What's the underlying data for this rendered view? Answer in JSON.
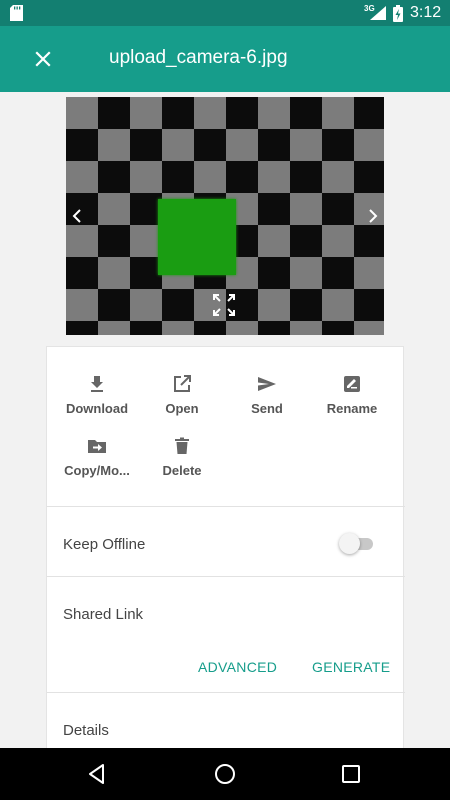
{
  "status_bar": {
    "network": "3G",
    "time": "3:12",
    "icons": [
      "sd-card-icon",
      "signal-icon",
      "battery-charging-icon"
    ]
  },
  "app_bar": {
    "title": "upload_camera-6.jpg",
    "close_icon": "close-icon"
  },
  "preview": {
    "icons": [
      "chevron-left-icon",
      "chevron-right-icon",
      "fullscreen-icon"
    ]
  },
  "actions": [
    {
      "label": "Download",
      "icon": "download-icon"
    },
    {
      "label": "Open",
      "icon": "open-external-icon"
    },
    {
      "label": "Send",
      "icon": "send-icon"
    },
    {
      "label": "Rename",
      "icon": "rename-icon"
    },
    {
      "label": "Copy/Mo...",
      "icon": "copy-move-icon"
    },
    {
      "label": "Delete",
      "icon": "trash-icon"
    }
  ],
  "keep_offline": {
    "label": "Keep Offline",
    "enabled": false
  },
  "shared_link": {
    "label": "Shared Link",
    "advanced_label": "ADVANCED",
    "generate_label": "GENERATE"
  },
  "details": {
    "label": "Details"
  },
  "colors": {
    "status_bar": "#137f71",
    "app_bar": "#169d8b",
    "accent": "#169d8b",
    "preview_square": "#1a9d12"
  }
}
